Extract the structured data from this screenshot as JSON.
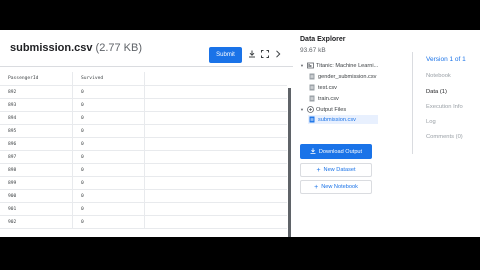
{
  "file": {
    "name": "submission.csv",
    "size": "(2.77 KB)",
    "submit_label": "Submit"
  },
  "table": {
    "headers": [
      "PassengerId",
      "Survived"
    ],
    "rows": [
      [
        "892",
        "0"
      ],
      [
        "893",
        "0"
      ],
      [
        "894",
        "0"
      ],
      [
        "895",
        "0"
      ],
      [
        "896",
        "0"
      ],
      [
        "897",
        "0"
      ],
      [
        "898",
        "0"
      ],
      [
        "899",
        "0"
      ],
      [
        "900",
        "0"
      ],
      [
        "901",
        "0"
      ],
      [
        "902",
        "0"
      ]
    ]
  },
  "explorer": {
    "title": "Data Explorer",
    "size": "93.67 kB",
    "tree": [
      {
        "label": "Titanic: Machine Learni...",
        "icon": "dataset-icon",
        "caret": "▼"
      },
      {
        "label": "gender_submission.csv",
        "icon": "file-icon"
      },
      {
        "label": "test.csv",
        "icon": "file-icon"
      },
      {
        "label": "train.csv",
        "icon": "file-icon"
      },
      {
        "label": "Output Files",
        "icon": "folder-icon",
        "caret": "▼"
      },
      {
        "label": "submission.csv",
        "icon": "file-icon"
      }
    ],
    "download_label": "Download Output",
    "new_dataset_label": "New Dataset",
    "new_notebook_label": "New Notebook"
  },
  "versions": {
    "label": "Version 1 of 1",
    "items": [
      "Notebook",
      "Data (1)",
      "Execution Info",
      "Log",
      "Comments (0)"
    ]
  },
  "colors": {
    "accent": "#1a73e8",
    "background": "#000000"
  }
}
